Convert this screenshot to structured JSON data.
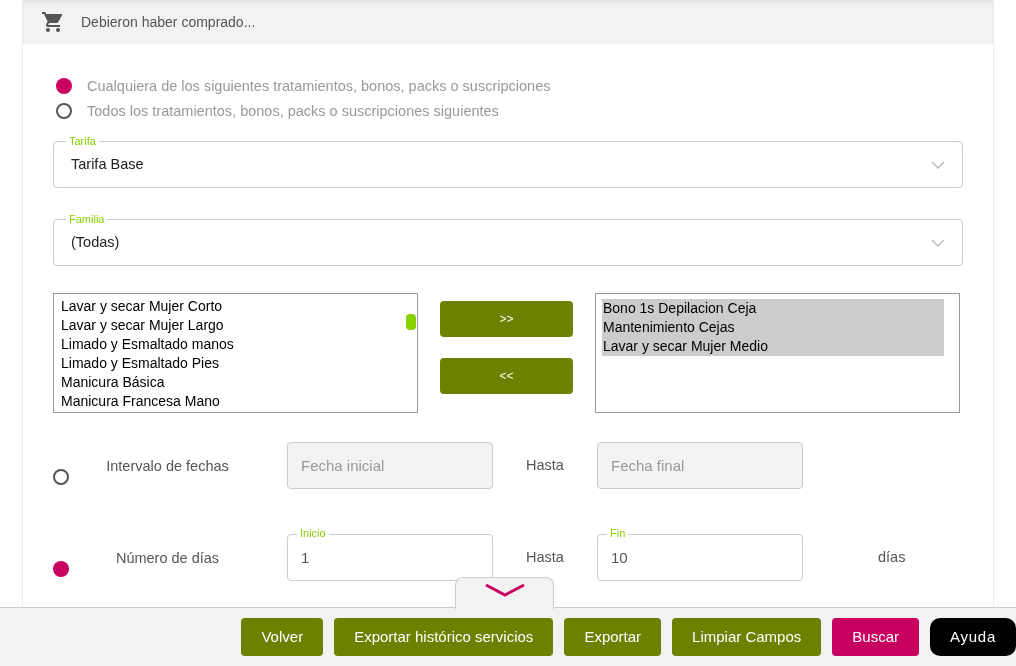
{
  "header": {
    "title": "Debieron haber comprado..."
  },
  "match_options": [
    {
      "label": "Cualquiera de los siguientes tratamientos, bonos, packs o suscripciones",
      "selected": true
    },
    {
      "label": "Todos los tratamientos, bonos, packs o suscripciones siguientes",
      "selected": false
    }
  ],
  "selects": [
    {
      "label": "Tarifa",
      "value": "Tarifa Base"
    },
    {
      "label": "Familia",
      "value": "(Todas)"
    }
  ],
  "available_list": [
    {
      "label": "Lavar y secar Mujer Corto",
      "selected": false
    },
    {
      "label": "Lavar y secar Mujer Largo",
      "selected": false
    },
    {
      "label": "Limado y Esmaltado manos",
      "selected": false
    },
    {
      "label": "Limado y Esmaltado Pies",
      "selected": false
    },
    {
      "label": "Manicura Básica",
      "selected": false
    },
    {
      "label": "Manicura Francesa Mano",
      "selected": false
    }
  ],
  "transfer_buttons": [
    ">>",
    "<<"
  ],
  "chosen_list": [
    {
      "label": "Bono 1s Depilacion Ceja",
      "selected": true
    },
    {
      "label": "Mantenimiento Cejas",
      "selected": true
    },
    {
      "label": "Lavar y secar Mujer Medio",
      "selected": true
    }
  ],
  "period_rows": [
    {
      "label": "Intervalo de fechas",
      "selected": false,
      "from": {
        "placeholder": "Fecha inicial"
      },
      "separator": "Hasta",
      "to": {
        "placeholder": "Fecha final"
      }
    },
    {
      "label": "Número de días",
      "selected": true,
      "from": {
        "label": "Inicio",
        "value": "1"
      },
      "separator": "Hasta",
      "to": {
        "label": "Fin",
        "value": "10"
      },
      "unit": "días"
    }
  ],
  "footer_buttons": [
    {
      "label": "Volver",
      "kind": "primary"
    },
    {
      "label": "Exportar histórico servicios",
      "kind": "primary"
    },
    {
      "label": "Exportar",
      "kind": "primary"
    },
    {
      "label": "Limpiar Campos",
      "kind": "primary"
    },
    {
      "label": "Buscar",
      "kind": "accent"
    },
    {
      "label": "Ayuda",
      "kind": "help"
    }
  ]
}
